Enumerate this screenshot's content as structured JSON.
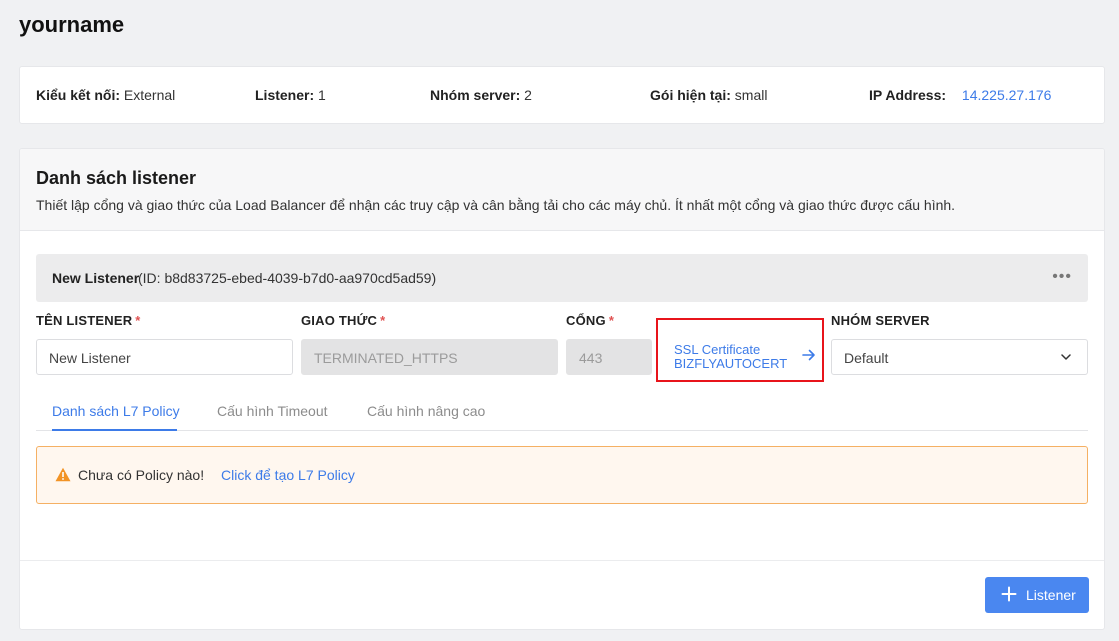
{
  "page": {
    "title": "yourname"
  },
  "info": {
    "connection_type_label": "Kiểu kết nối:",
    "connection_type_value": "External",
    "listener_label": "Listener:",
    "listener_value": "1",
    "server_group_label": "Nhóm server:",
    "server_group_value": "2",
    "plan_label": "Gói hiện tại:",
    "plan_value": "small",
    "ip_label": "IP Address:",
    "ip_value": "14.225.27.176"
  },
  "listener_section": {
    "title": "Danh sách listener",
    "description": "Thiết lập cổng và giao thức của Load Balancer để nhận các truy cập và cân bằng tải cho các máy chủ. Ít nhất một cổng và giao thức được cấu hình."
  },
  "listener": {
    "name": "New Listener",
    "id_text": "(ID: b8d83725-ebed-4039-b7d0-aa970cd5ad59)",
    "more_icon": "•••"
  },
  "form": {
    "name_label": "TÊN LISTENER",
    "name_value": "New Listener",
    "protocol_label": "GIAO THỨC",
    "protocol_value": "TERMINATED_HTTPS",
    "port_label": "CỔNG",
    "port_value": "443",
    "required_mark": "*",
    "ssl_line1": "SSL Certificate",
    "ssl_line2": "BIZFLYAUTOCERT",
    "server_group_label": "NHÓM SERVER",
    "server_group_value": "Default"
  },
  "tabs": [
    {
      "label": "Danh sách L7 Policy",
      "active": true
    },
    {
      "label": "Cấu hình Timeout",
      "active": false
    },
    {
      "label": "Cấu hình nâng cao",
      "active": false
    }
  ],
  "alert": {
    "message": "Chưa có Policy nào!",
    "link": "Click để tạo L7 Policy"
  },
  "footer": {
    "add_button": "Listener"
  },
  "colors": {
    "accent": "#3d7be8",
    "warning": "#f5b063",
    "highlight": "#e8141b"
  },
  "icons": [
    "more-icon",
    "arrow-right-icon",
    "chevron-down-icon",
    "warning-icon",
    "plus-icon"
  ]
}
